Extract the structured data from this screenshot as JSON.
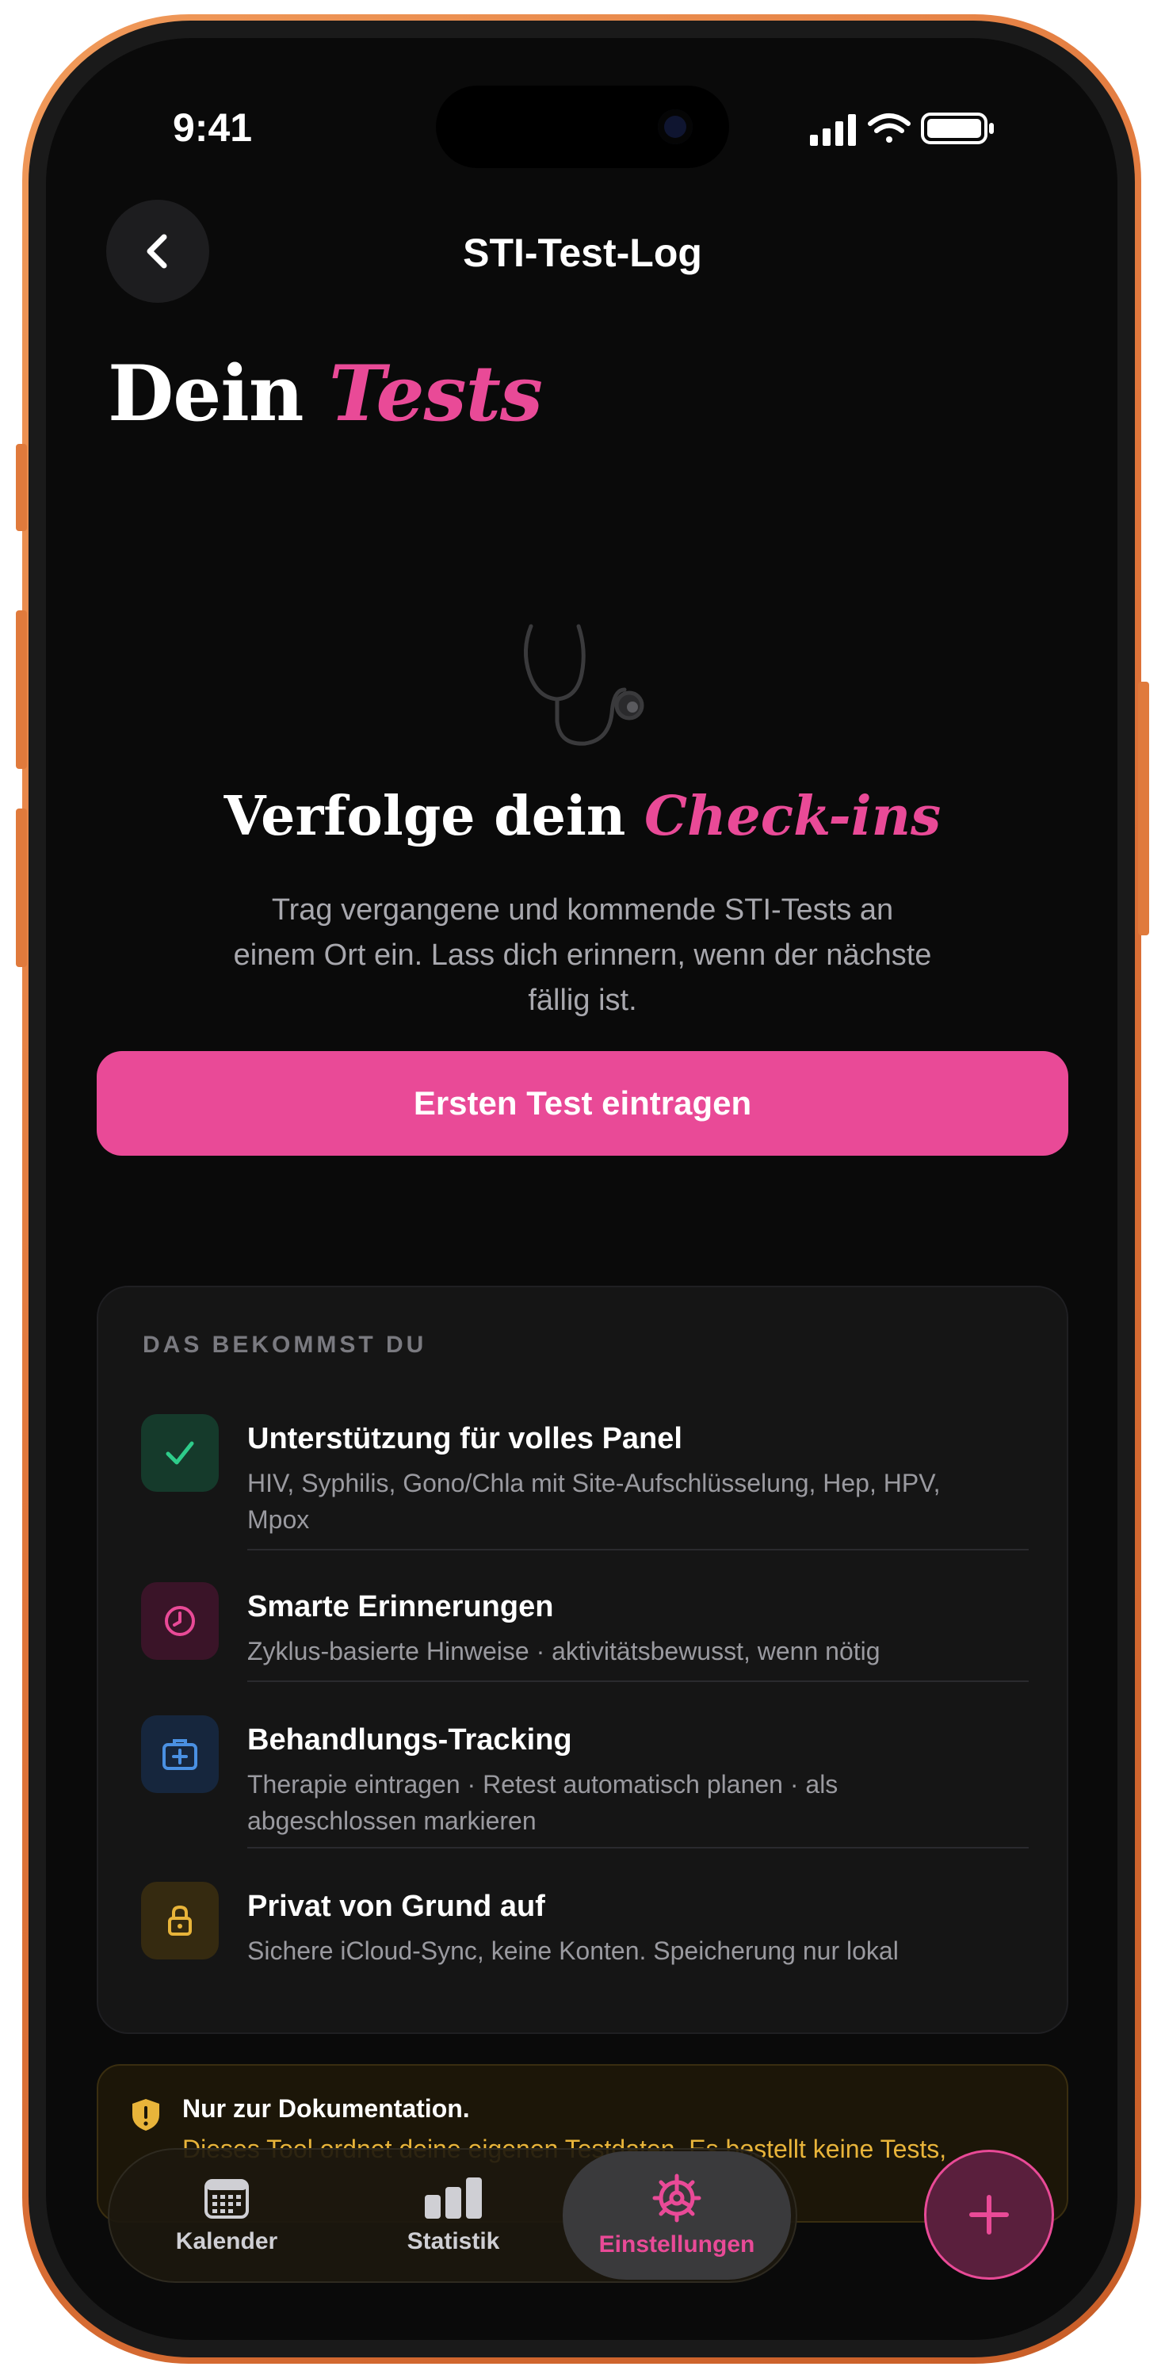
{
  "status_bar": {
    "time": "9:41"
  },
  "nav": {
    "title": "STI-Test-Log",
    "back_icon": "chevron-left-icon"
  },
  "heading": {
    "plain": "Dein ",
    "accent": "Tests"
  },
  "empty_state": {
    "icon": "stethoscope-icon",
    "title_plain": "Verfolge dein ",
    "title_accent": "Check-ins",
    "description": "Trag vergangene und kommende STI-Tests an einem Ort ein. Lass dich erinnern, wenn der nächste fällig ist.",
    "cta_label": "Ersten Test eintragen"
  },
  "features": {
    "label": "DAS BEKOMMST DU",
    "items": [
      {
        "title": "Unterstützung für volles Panel",
        "description": "HIV, Syphilis, Gono/Chla mit Site-Aufschlüsselung, Hep, HPV, Mpox",
        "icon": "checkmark-icon",
        "color": "#2ecc8a"
      },
      {
        "title": "Smarte Erinnerungen",
        "description": "Zyklus-basierte Hinweise · aktivitätsbewusst, wenn nötig",
        "icon": "clock-icon",
        "color": "#e94a97"
      },
      {
        "title": "Behandlungs-Tracking",
        "description": "Therapie eintragen · Retest automatisch planen · als abgeschlossen markieren",
        "icon": "medical-kit-icon",
        "color": "#4a90e2"
      },
      {
        "title": "Privat von Grund auf",
        "description": "Sichere iCloud-Sync, keine Konten. Speicherung nur lokal",
        "icon": "lock-icon",
        "color": "#e8b43a"
      }
    ]
  },
  "banner": {
    "icon": "shield-warning-icon",
    "title": "Nur zur Dokumentation.",
    "text": "Dieses Tool ordnet deine eigenen Testdaten. Es bestellt keine Tests,"
  },
  "tabbar": {
    "items": [
      {
        "label": "Kalender",
        "icon": "calendar-icon",
        "active": false
      },
      {
        "label": "Statistik",
        "icon": "bar-chart-icon",
        "active": false
      },
      {
        "label": "Einstellungen",
        "icon": "settings-icon",
        "active": true
      }
    ],
    "fab_icon": "plus-icon"
  },
  "colors": {
    "accent": "#e94a97",
    "background": "#0a0a0a",
    "warning": "#e8b43a",
    "frame": "#e07a3c"
  }
}
